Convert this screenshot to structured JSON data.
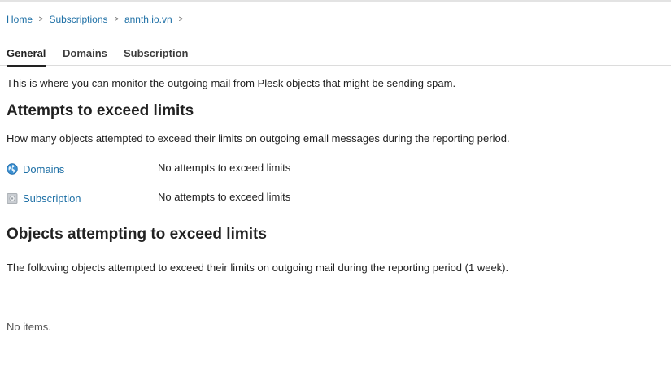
{
  "breadcrumb": {
    "items": [
      "Home",
      "Subscriptions",
      "annth.io.vn"
    ],
    "separator": ">"
  },
  "tabs": [
    {
      "label": "General",
      "active": true
    },
    {
      "label": "Domains",
      "active": false
    },
    {
      "label": "Subscription",
      "active": false
    }
  ],
  "intro": "This is where you can monitor the outgoing mail from Plesk objects that might be sending spam.",
  "attempts": {
    "title": "Attempts to exceed limits",
    "description": "How many objects attempted to exceed their limits on outgoing email messages during the reporting period.",
    "rows": [
      {
        "label": "Domains",
        "status": "No attempts to exceed limits",
        "icon": "globe-icon"
      },
      {
        "label": "Subscription",
        "status": "No attempts to exceed limits",
        "icon": "subscription-icon"
      }
    ]
  },
  "objects": {
    "title": "Objects attempting to exceed limits",
    "description": "The following objects attempted to exceed their limits on outgoing mail during the reporting period (1 week).",
    "empty_text": "No items."
  },
  "colors": {
    "link": "#1d6fa5",
    "text": "#222222"
  }
}
